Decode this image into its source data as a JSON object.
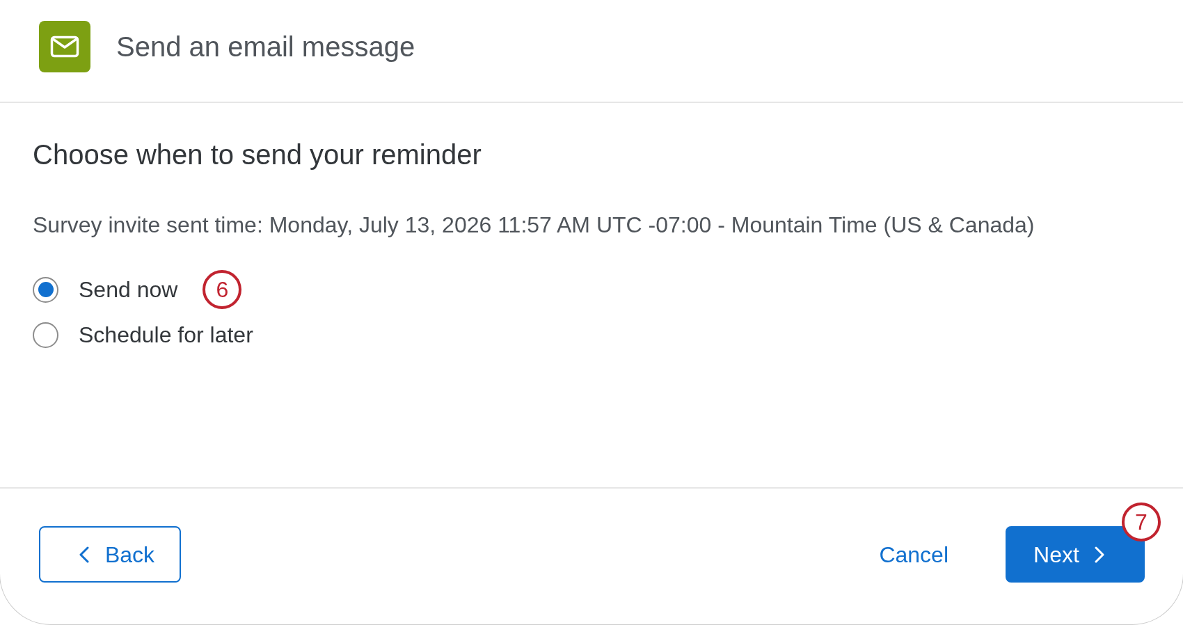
{
  "header": {
    "title": "Send an email message"
  },
  "body": {
    "heading": "Choose when to send your reminder",
    "info": "Survey invite sent time: Monday, July 13, 2026 11:57 AM UTC -07:00 - Mountain Time (US & Canada)",
    "options": [
      {
        "label": "Send now",
        "selected": true,
        "callout": "6"
      },
      {
        "label": "Schedule for later",
        "selected": false
      }
    ]
  },
  "footer": {
    "buttons": [
      {
        "kind": "back",
        "label": "Back"
      },
      {
        "kind": "cancel",
        "label": "Cancel"
      },
      {
        "kind": "next",
        "label": "Next",
        "callout": "7"
      }
    ]
  }
}
